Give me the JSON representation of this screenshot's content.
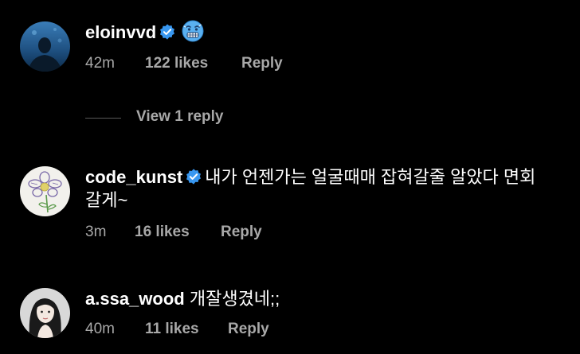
{
  "comments": [
    {
      "username": "eloinvvd",
      "verified": true,
      "text": "",
      "emoji": "cold-face-emoji",
      "time": "42m",
      "likes": "122 likes",
      "reply": "Reply"
    },
    {
      "username": "code_kunst",
      "verified": true,
      "text": "내가 언젠가는 얼굴때매 잡혀갈줄 알았다 면회",
      "text_cont": "갈게~",
      "time": "3m",
      "likes": "16 likes",
      "reply": "Reply"
    },
    {
      "username": "a.ssa_wood",
      "verified": false,
      "text": "개잘생겼네;;",
      "time": "40m",
      "likes": "11 likes",
      "reply": "Reply"
    }
  ],
  "view_replies": "View 1 reply",
  "colors": {
    "background": "#000000",
    "primary_text": "#ffffff",
    "secondary_text": "#a8a8a8",
    "verified_badge": "#3897f0",
    "divider": "#5a5a5a"
  }
}
